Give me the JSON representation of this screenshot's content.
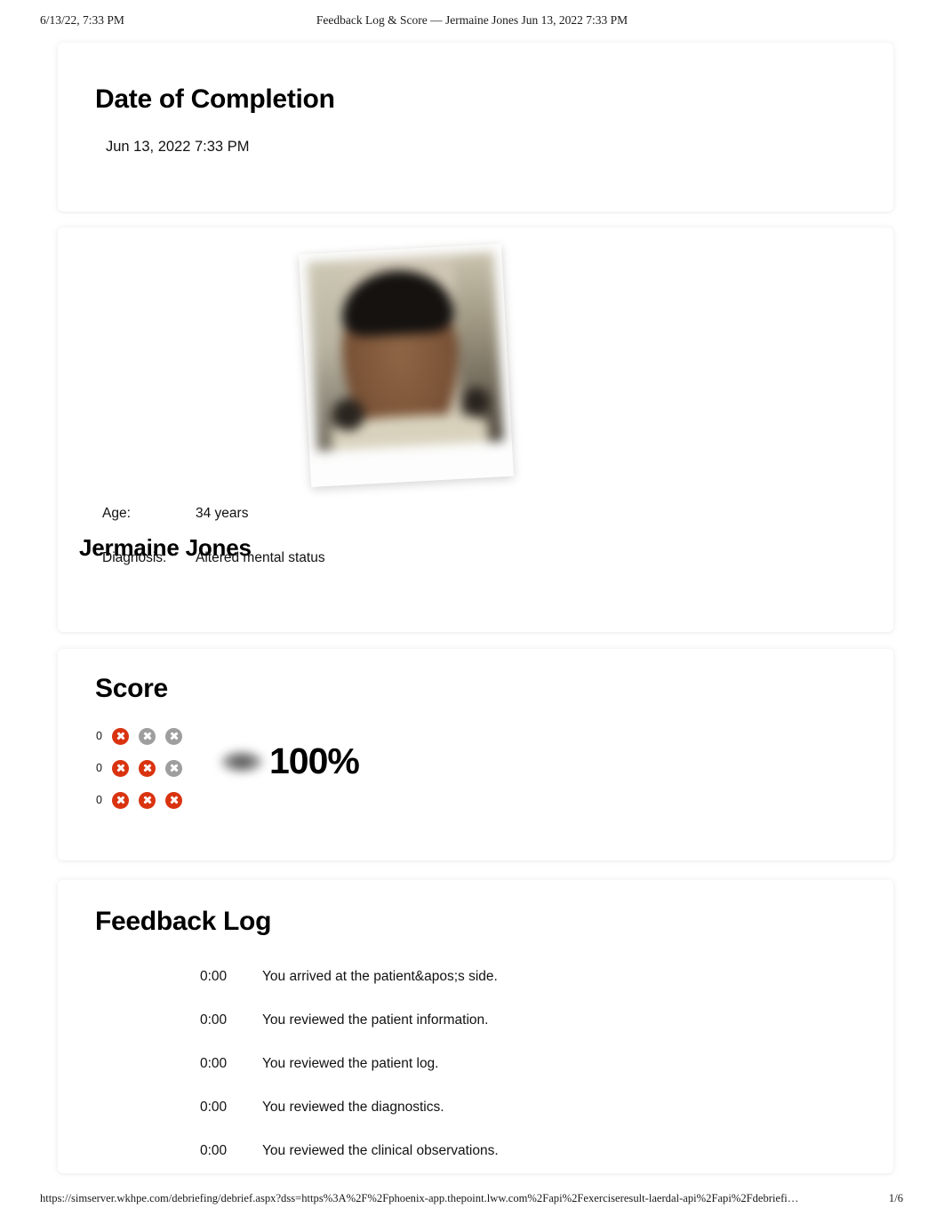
{
  "print": {
    "header_left": "6/13/22, 7:33 PM",
    "header_center": "Feedback Log & Score — Jermaine Jones Jun 13, 2022 7:33 PM",
    "footer_url": "https://simserver.wkhpe.com/debriefing/debrief.aspx?dss=https%3A%2F%2Fphoenix-app.thepoint.lww.com%2Fapi%2Fexerciseresult-laerdal-api%2Fapi%2Fdebriefi…",
    "footer_page": "1/6"
  },
  "date_card": {
    "title": "Date of Completion",
    "value": "Jun 13, 2022 7:33 PM"
  },
  "patient_card": {
    "name": "Jermaine Jones",
    "photo_alt": "patient-photo",
    "fields": [
      {
        "label": "Age:",
        "value": "34 years"
      },
      {
        "label": "Diagnosis:",
        "value": "Altered mental status"
      }
    ]
  },
  "score_card": {
    "title": "Score",
    "percent": "100%",
    "colors": {
      "red": "#d9330f",
      "gray": "#9e9e9e"
    },
    "rows": [
      {
        "count": "0",
        "marks": [
          "red",
          "gray",
          "gray"
        ]
      },
      {
        "count": "0",
        "marks": [
          "red",
          "red",
          "gray"
        ]
      },
      {
        "count": "0",
        "marks": [
          "red",
          "red",
          "red"
        ]
      }
    ]
  },
  "feedback_card": {
    "title": "Feedback Log",
    "entries": [
      {
        "time": "0:00",
        "text": "You arrived at the patient&apos;s side."
      },
      {
        "time": "0:00",
        "text": "You reviewed the patient information."
      },
      {
        "time": "0:00",
        "text": "You reviewed the patient log."
      },
      {
        "time": "0:00",
        "text": "You reviewed the diagnostics."
      },
      {
        "time": "0:00",
        "text": "You reviewed the clinical observations."
      }
    ]
  }
}
